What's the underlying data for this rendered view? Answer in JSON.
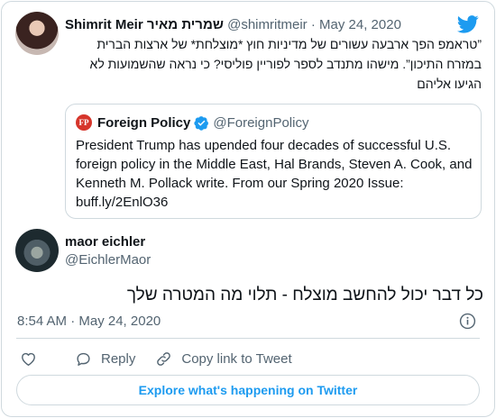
{
  "parent_tweet": {
    "author_name": "Shimrit Meir שמרית מאיר",
    "handle": "@shimritmeir",
    "separator": " · ",
    "date": "May 24, 2020",
    "text": "”טראמפ הפך ארבעה עשורים של מדיניות חוץ *מוצלחת* של ארצות הברית במזרח התיכון”. מישהו מתנדב לספר לפוריין פוליסי? כי נראה שהשמועות לא הגיעו אליהם"
  },
  "quoted_tweet": {
    "logo_text": "FP",
    "author_name": "Foreign Policy",
    "handle": "@ForeignPolicy",
    "text": "President Trump has upended four decades of successful U.S. foreign policy in the Middle East, Hal Brands, Steven A. Cook, and Kenneth M. Pollack write. From our Spring 2020 Issue: buff.ly/2EnlO36"
  },
  "main_tweet": {
    "author_name": "maor eichler",
    "handle": "@EichlerMaor",
    "text": "כל דבר יכול להחשב מוצלח - תלוי מה המטרה שלך",
    "timestamp": "8:54 AM · May 24, 2020"
  },
  "actions": {
    "reply_label": "Reply",
    "copy_label": "Copy link to Tweet"
  },
  "footer": {
    "explore_label": "Explore what's happening on Twitter"
  },
  "icons": {
    "brand": "twitter-bird-icon",
    "verified": "verified-badge-icon",
    "info": "info-icon",
    "like": "heart-icon",
    "reply": "speech-bubble-icon",
    "copy": "link-icon"
  },
  "colors": {
    "accent": "#1d9bf0",
    "text": "#0f1419",
    "muted": "#536471",
    "border": "#cfd9de"
  }
}
